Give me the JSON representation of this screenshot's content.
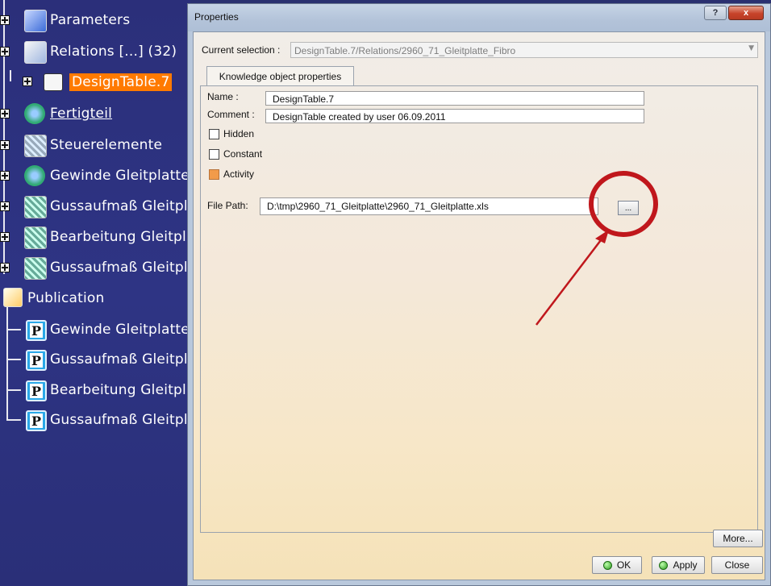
{
  "tree": {
    "items": [
      {
        "label": "Parameters",
        "icon": "parameters-icon"
      },
      {
        "label": "Relations [...] (32)",
        "icon": "relations-icon"
      },
      {
        "label": "DesignTable.7",
        "icon": "design-table-icon"
      },
      {
        "label": "Fertigteil",
        "icon": "part-body-icon"
      },
      {
        "label": "Steuerelemente",
        "icon": "geometrical-set-icon"
      },
      {
        "label": "Gewinde Gleitplatte",
        "icon": "part-body-icon"
      },
      {
        "label": "Gussaufmaß Gleitpla",
        "icon": "geometrical-set-icon"
      },
      {
        "label": "Bearbeitung Gleitpla",
        "icon": "geometrical-set-icon"
      },
      {
        "label": "Gussaufmaß Gleitpla",
        "icon": "geometrical-set-icon"
      },
      {
        "label": "Publication",
        "icon": "publication-icon"
      }
    ],
    "publications": [
      {
        "label": "Gewinde Gleitplatte"
      },
      {
        "label": "Gussaufmaß Gleitpla"
      },
      {
        "label": "Bearbeitung Gleitpla"
      },
      {
        "label": "Gussaufmaß Gleitpla"
      }
    ],
    "selected_color": "#ff7a00"
  },
  "dialog": {
    "title": "Properties",
    "help_label": "?",
    "close_label": "x",
    "current_selection_label": "Current selection :",
    "current_selection_value": "DesignTable.7/Relations/2960_71_Gleitplatte_Fibro",
    "tab_label": "Knowledge object properties",
    "name_label": "Name :",
    "name_value": "DesignTable.7",
    "comment_label": "Comment :",
    "comment_value": "DesignTable created by user 06.09.2011",
    "hidden_label": "Hidden",
    "hidden_checked": false,
    "constant_label": "Constant",
    "constant_checked": false,
    "activity_label": "Activity",
    "activity_checked": true,
    "filepath_label": "File Path:",
    "filepath_value": "D:\\tmp\\2960_71_Gleitplatte\\2960_71_Gleitplatte.xls",
    "browse_label": "...",
    "more_label": "More...",
    "ok_label": "OK",
    "apply_label": "Apply",
    "close_button_label": "Close"
  },
  "annotation": {
    "color": "#c0171c"
  }
}
